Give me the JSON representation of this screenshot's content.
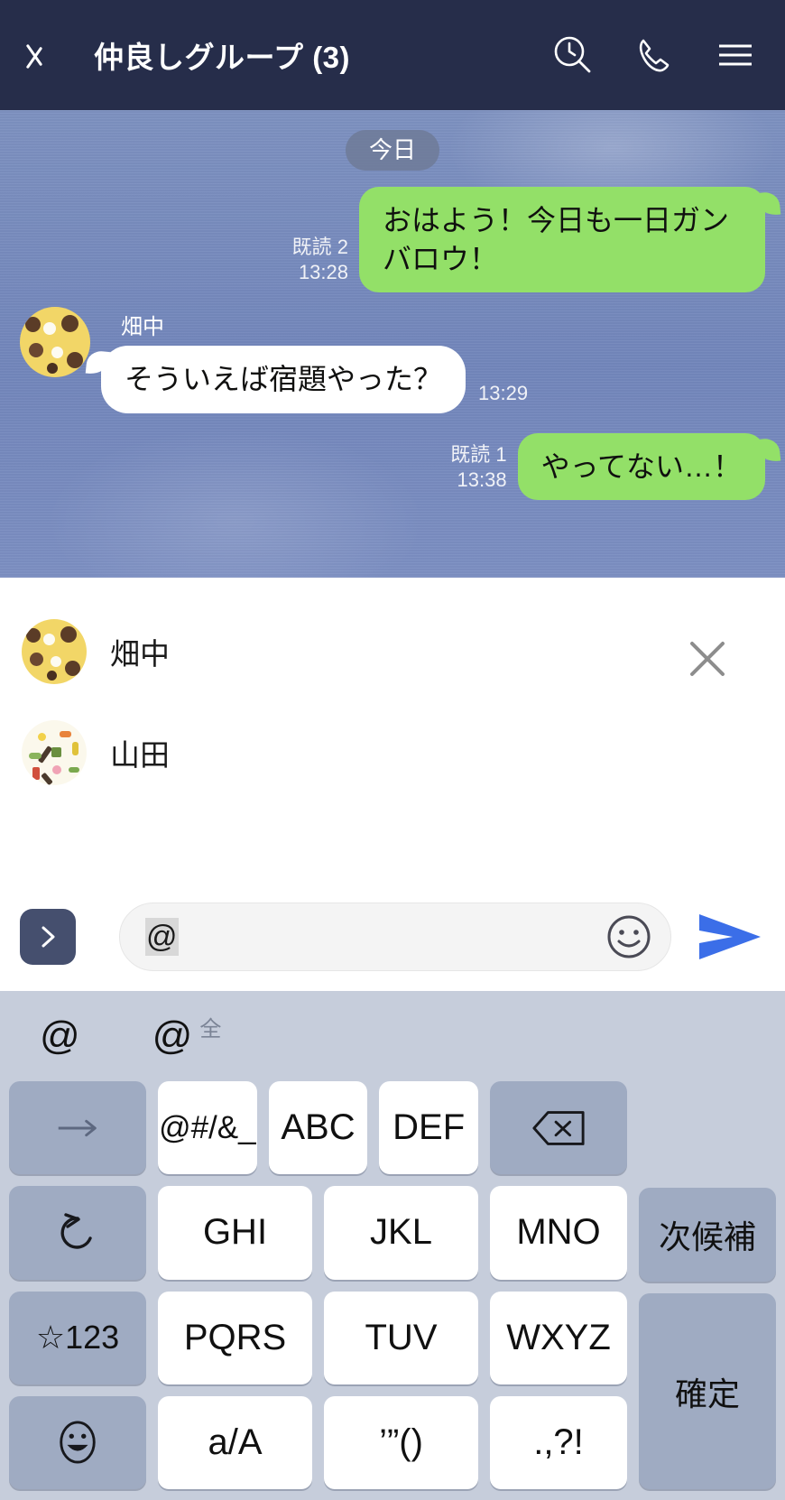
{
  "header": {
    "back_icon": "chevron-left-icon",
    "title": "仲良しグループ (3)",
    "icons": [
      "search-history-icon",
      "phone-icon",
      "menu-icon"
    ]
  },
  "chat": {
    "date_badge": "今日",
    "messages": [
      {
        "side": "out",
        "text": "おはよう！今日も一日ガンバロウ！",
        "read_label": "既読 2",
        "time": "13:28"
      },
      {
        "side": "in",
        "sender": "畑中",
        "text": "そういえば宿題やった？",
        "time": "13:29"
      },
      {
        "side": "out",
        "text": "やってない…！",
        "read_label": "既読 1",
        "time": "13:38"
      }
    ]
  },
  "mention_panel": {
    "close_icon": "close-icon",
    "items": [
      {
        "name": "畑中",
        "avatar": "hatanaka-avatar"
      },
      {
        "name": "山田",
        "avatar": "yamada-avatar"
      }
    ]
  },
  "input_bar": {
    "expand_icon": "chevron-right-icon",
    "value": "@",
    "emoji_icon": "smiley-icon",
    "send_icon": "send-icon"
  },
  "keyboard": {
    "candidates": [
      {
        "glyph": "@",
        "sup": ""
      },
      {
        "glyph": "@",
        "sup": "全"
      }
    ],
    "rows": [
      [
        {
          "label": "→",
          "type": "fn",
          "name": "cursor-right-key"
        },
        {
          "label": "@#/&_",
          "type": "white",
          "name": "symbol-key"
        },
        {
          "label": "ABC",
          "type": "white",
          "name": "abc-key"
        },
        {
          "label": "DEF",
          "type": "white",
          "name": "def-key"
        },
        {
          "label": "⌫",
          "type": "fn",
          "name": "backspace-key"
        }
      ],
      [
        {
          "label": "↺",
          "type": "fn",
          "name": "undo-key"
        },
        {
          "label": "GHI",
          "type": "white",
          "name": "ghi-key"
        },
        {
          "label": "JKL",
          "type": "white",
          "name": "jkl-key"
        },
        {
          "label": "MNO",
          "type": "white",
          "name": "mno-key"
        },
        {
          "label": "次候補",
          "type": "fn",
          "name": "next-candidate-key"
        }
      ],
      [
        {
          "label": "☆123",
          "type": "fn",
          "name": "symbols-numbers-key"
        },
        {
          "label": "PQRS",
          "type": "white",
          "name": "pqrs-key"
        },
        {
          "label": "TUV",
          "type": "white",
          "name": "tuv-key"
        },
        {
          "label": "WXYZ",
          "type": "white",
          "name": "wxyz-key"
        },
        {
          "label": "確定",
          "type": "fn",
          "name": "confirm-key"
        }
      ],
      [
        {
          "label": "☺",
          "type": "fn",
          "name": "emoji-key"
        },
        {
          "label": "a/A",
          "type": "white",
          "name": "case-toggle-key"
        },
        {
          "label": "’”()",
          "type": "white",
          "name": "quotes-parens-key"
        },
        {
          "label": ".,?!",
          "type": "white",
          "name": "punctuation-key"
        }
      ]
    ]
  },
  "colors": {
    "header_bg": "#262d4a",
    "chat_bg": "#7286bb",
    "bubble_out": "#93e068",
    "bubble_in": "#ffffff",
    "keyboard_bg": "#c6cddb",
    "key_fn": "#9fabc2",
    "send_blue": "#3b6ee8"
  }
}
